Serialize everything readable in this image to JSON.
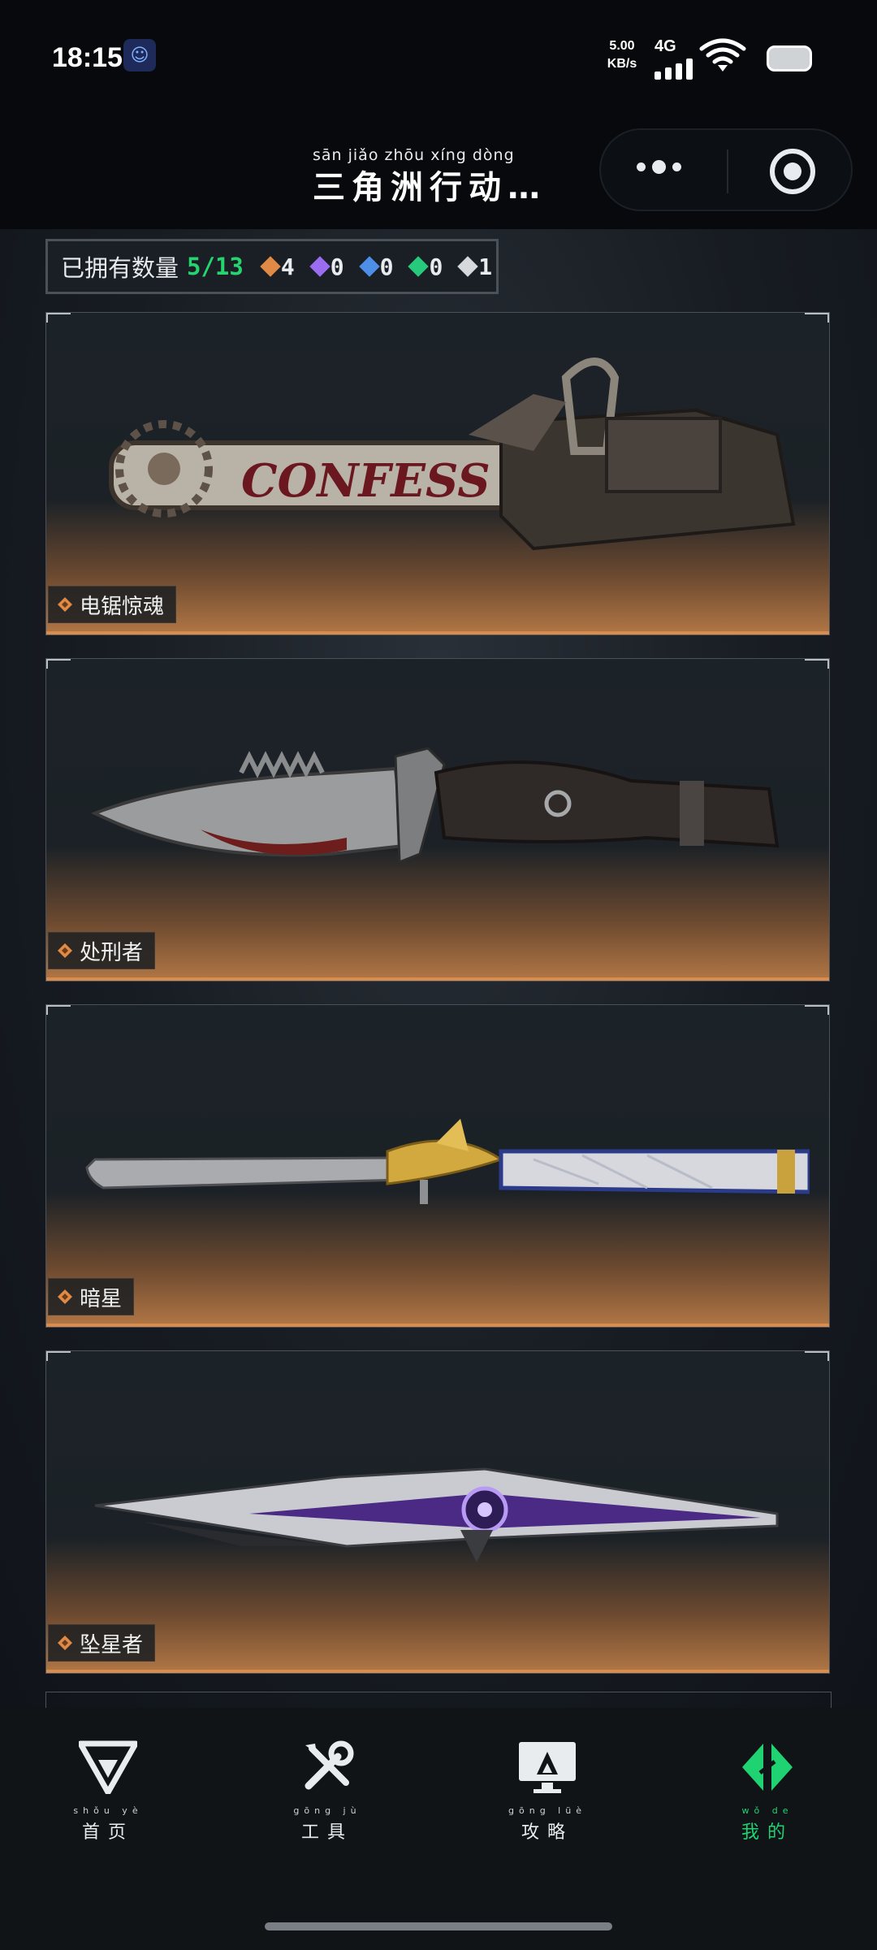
{
  "status_bar": {
    "time": "18:15",
    "net_speed_value": "5.00",
    "net_speed_unit": "KB/s",
    "network": "4G",
    "icons": [
      "app-robot-icon",
      "signal-icon",
      "wifi-icon",
      "battery-icon"
    ]
  },
  "titlebar": {
    "pinyin": "sān jiǎo zhōu xíng dòng",
    "title": "三角洲行动…",
    "more_icon": "more-dots-icon",
    "close_icon": "close-ring-icon"
  },
  "collection": {
    "owned_label": "已拥有数量",
    "owned_value": "5/13",
    "rarities": [
      {
        "name": "orange-gem-icon",
        "color": "#e08a45",
        "count": "4"
      },
      {
        "name": "purple-gem-icon",
        "color": "#9a6cf0",
        "count": "0"
      },
      {
        "name": "blue-gem-icon",
        "color": "#4d8fe6",
        "count": "0"
      },
      {
        "name": "green-gem-icon",
        "color": "#27c97a",
        "count": "0"
      },
      {
        "name": "white-gem-icon",
        "color": "#d6d9dc",
        "count": "1"
      }
    ]
  },
  "items": [
    {
      "name": "电锯惊魂",
      "rarity_color": "#e08a45",
      "weapon": "chainsaw",
      "engraving": "CONFESS"
    },
    {
      "name": "处刑者",
      "rarity_color": "#e08a45",
      "weapon": "tactical-knife"
    },
    {
      "name": "暗星",
      "rarity_color": "#e08a45",
      "weapon": "gold-eagle-knife"
    },
    {
      "name": "坠星者",
      "rarity_color": "#e08a45",
      "weapon": "purple-blade"
    }
  ],
  "bottom_nav": [
    {
      "pinyin": "shǒu yè",
      "label": "首页",
      "icon": "home-logo-icon",
      "active": false
    },
    {
      "pinyin": "gōng jù",
      "label": "工具",
      "icon": "tools-icon",
      "active": false
    },
    {
      "pinyin": "gōng lüè",
      "label": "攻略",
      "icon": "guide-monitor-icon",
      "active": false
    },
    {
      "pinyin": "wǒ de",
      "label": "我的",
      "icon": "profile-logo-icon",
      "active": true
    }
  ],
  "colors": {
    "accent": "#1fd373",
    "card_glow": "#d88d4e",
    "background": "#0b0f13"
  }
}
